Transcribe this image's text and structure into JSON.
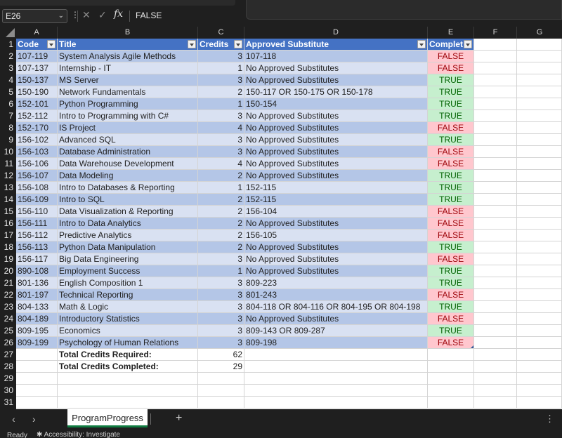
{
  "formula_bar": {
    "name_box": "E26",
    "formula": "FALSE",
    "fx_label": "fx",
    "cancel_glyph": "✕",
    "enter_glyph": "✓"
  },
  "columns": [
    "A",
    "B",
    "C",
    "D",
    "E",
    "F",
    "G"
  ],
  "table": {
    "headers": [
      "Code",
      "Title",
      "Credits",
      "Approved Substitute",
      "Complet"
    ],
    "rows": [
      {
        "row": "2",
        "code": "107-119",
        "title": "System Analysis Agile Methods",
        "credits": "3",
        "substitute": "107-118",
        "completed": "FALSE"
      },
      {
        "row": "3",
        "code": "107-137",
        "title": "Internship - IT",
        "credits": "1",
        "substitute": "No Approved Substitutes",
        "completed": "FALSE"
      },
      {
        "row": "4",
        "code": "150-137",
        "title": "MS Server",
        "credits": "3",
        "substitute": "No Approved Substitutes",
        "completed": "TRUE"
      },
      {
        "row": "5",
        "code": "150-190",
        "title": "Network Fundamentals",
        "credits": "2",
        "substitute": "150-117 OR 150-175 OR 150-178",
        "completed": "TRUE"
      },
      {
        "row": "6",
        "code": "152-101",
        "title": "Python Programming",
        "credits": "1",
        "substitute": "150-154",
        "completed": "TRUE"
      },
      {
        "row": "7",
        "code": "152-112",
        "title": "Intro to Programming with C#",
        "credits": "3",
        "substitute": "No Approved Substitutes",
        "completed": "TRUE"
      },
      {
        "row": "8",
        "code": "152-170",
        "title": "IS Project",
        "credits": "4",
        "substitute": "No Approved Substitutes",
        "completed": "FALSE"
      },
      {
        "row": "9",
        "code": "156-102",
        "title": "Advanced SQL",
        "credits": "3",
        "substitute": "No Approved Substitutes",
        "completed": "TRUE"
      },
      {
        "row": "10",
        "code": "156-103",
        "title": "Database Administration",
        "credits": "3",
        "substitute": "No Approved Substitutes",
        "completed": "FALSE"
      },
      {
        "row": "11",
        "code": "156-106",
        "title": "Data Warehouse Development",
        "credits": "4",
        "substitute": "No Approved Substitutes",
        "completed": "FALSE"
      },
      {
        "row": "12",
        "code": "156-107",
        "title": "Data Modeling",
        "credits": "2",
        "substitute": "No Approved Substitutes",
        "completed": "TRUE"
      },
      {
        "row": "13",
        "code": "156-108",
        "title": "Intro to Databases & Reporting",
        "credits": "1",
        "substitute": "152-115",
        "completed": "TRUE"
      },
      {
        "row": "14",
        "code": "156-109",
        "title": "Intro to SQL",
        "credits": "2",
        "substitute": "152-115",
        "completed": "TRUE"
      },
      {
        "row": "15",
        "code": "156-110",
        "title": "Data Visualization & Reporting",
        "credits": "2",
        "substitute": "156-104",
        "completed": "FALSE"
      },
      {
        "row": "16",
        "code": "156-111",
        "title": "Intro to Data Analytics",
        "credits": "2",
        "substitute": "No Approved Substitutes",
        "completed": "FALSE"
      },
      {
        "row": "17",
        "code": "156-112",
        "title": "Predictive Analytics",
        "credits": "2",
        "substitute": "156-105",
        "completed": "FALSE"
      },
      {
        "row": "18",
        "code": "156-113",
        "title": "Python Data Manipulation",
        "credits": "2",
        "substitute": "No Approved Substitutes",
        "completed": "TRUE"
      },
      {
        "row": "19",
        "code": "156-117",
        "title": "Big Data Engineering",
        "credits": "3",
        "substitute": "No Approved Substitutes",
        "completed": "FALSE"
      },
      {
        "row": "20",
        "code": "890-108",
        "title": "Employment Success",
        "credits": "1",
        "substitute": "No Approved Substitutes",
        "completed": "TRUE"
      },
      {
        "row": "21",
        "code": "801-136",
        "title": "English Composition 1",
        "credits": "3",
        "substitute": "809-223",
        "completed": "TRUE"
      },
      {
        "row": "22",
        "code": "801-197",
        "title": "Technical Reporting",
        "credits": "3",
        "substitute": "801-243",
        "completed": "FALSE"
      },
      {
        "row": "23",
        "code": "804-133",
        "title": "Math & Logic",
        "credits": "3",
        "substitute": "804-118 OR 804-116 OR 804-195 OR 804-198",
        "completed": "TRUE"
      },
      {
        "row": "24",
        "code": "804-189",
        "title": "Introductory Statistics",
        "credits": "3",
        "substitute": "No Approved Substitutes",
        "completed": "FALSE"
      },
      {
        "row": "25",
        "code": "809-195",
        "title": "Economics",
        "credits": "3",
        "substitute": "809-143 OR 809-287",
        "completed": "TRUE"
      },
      {
        "row": "26",
        "code": "809-199",
        "title": "Psychology of Human Relations",
        "credits": "3",
        "substitute": "809-198",
        "completed": "FALSE"
      }
    ]
  },
  "totals": [
    {
      "row": "27",
      "label": "Total Credits Required:",
      "value": "62"
    },
    {
      "row": "28",
      "label": "Total Credits Completed:",
      "value": "29"
    }
  ],
  "row_numbers": [
    "1",
    "2",
    "3",
    "4",
    "5",
    "6",
    "7",
    "8",
    "9",
    "10",
    "11",
    "12",
    "13",
    "14",
    "15",
    "16",
    "17",
    "18",
    "19",
    "20",
    "21",
    "22",
    "23",
    "24",
    "25",
    "26",
    "27",
    "28",
    "29",
    "30",
    "31"
  ],
  "sheet_tabs": {
    "active": "ProgramProgress",
    "add_label": "+",
    "menu_glyph": "⋮",
    "prev_glyph": "‹",
    "next_glyph": "›"
  },
  "status": {
    "ready": "Ready",
    "accessibility": "Accessibility: Investigate"
  },
  "colors": {
    "header_blue": "#4472c4",
    "band_dark": "#b4c6e7",
    "band_light": "#d9e1f2",
    "false_fill": "#ffc7ce",
    "false_text": "#9c0006",
    "true_fill": "#c6efce",
    "true_text": "#006100",
    "tab_accent": "#107c41"
  }
}
